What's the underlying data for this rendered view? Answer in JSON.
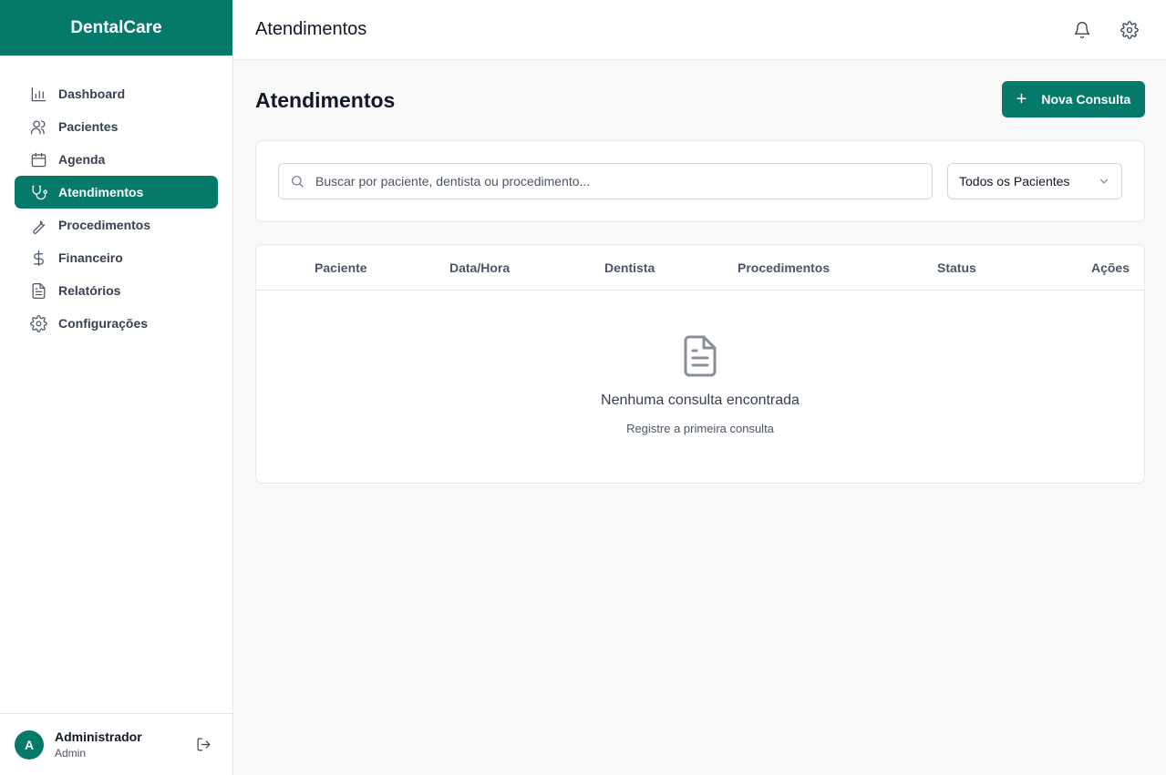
{
  "app": {
    "brand": "DentalCare"
  },
  "sidebar": {
    "items": [
      {
        "label": "Dashboard",
        "icon": "bar-chart-icon"
      },
      {
        "label": "Pacientes",
        "icon": "users-icon"
      },
      {
        "label": "Agenda",
        "icon": "calendar-icon"
      },
      {
        "label": "Atendimentos",
        "icon": "stethoscope-icon",
        "active": true
      },
      {
        "label": "Procedimentos",
        "icon": "wrench-icon"
      },
      {
        "label": "Financeiro",
        "icon": "dollar-icon"
      },
      {
        "label": "Relatórios",
        "icon": "file-text-icon"
      },
      {
        "label": "Configurações",
        "icon": "gear-icon"
      }
    ],
    "user": {
      "initial": "A",
      "name": "Administrador",
      "role": "Admin"
    }
  },
  "topbar": {
    "title": "Atendimentos"
  },
  "main": {
    "title": "Atendimentos",
    "new_button": "Nova Consulta",
    "search": {
      "placeholder": "Buscar por paciente, dentista ou procedimento...",
      "value": ""
    },
    "filter": {
      "selected": "Todos os Pacientes"
    },
    "table": {
      "columns": [
        "Paciente",
        "Data/Hora",
        "Dentista",
        "Procedimentos",
        "Status",
        "Ações"
      ],
      "rows": [],
      "empty_title": "Nenhuma consulta encontrada",
      "empty_subtitle": "Registre a primeira consulta"
    }
  },
  "colors": {
    "primary": "#067a6a"
  }
}
